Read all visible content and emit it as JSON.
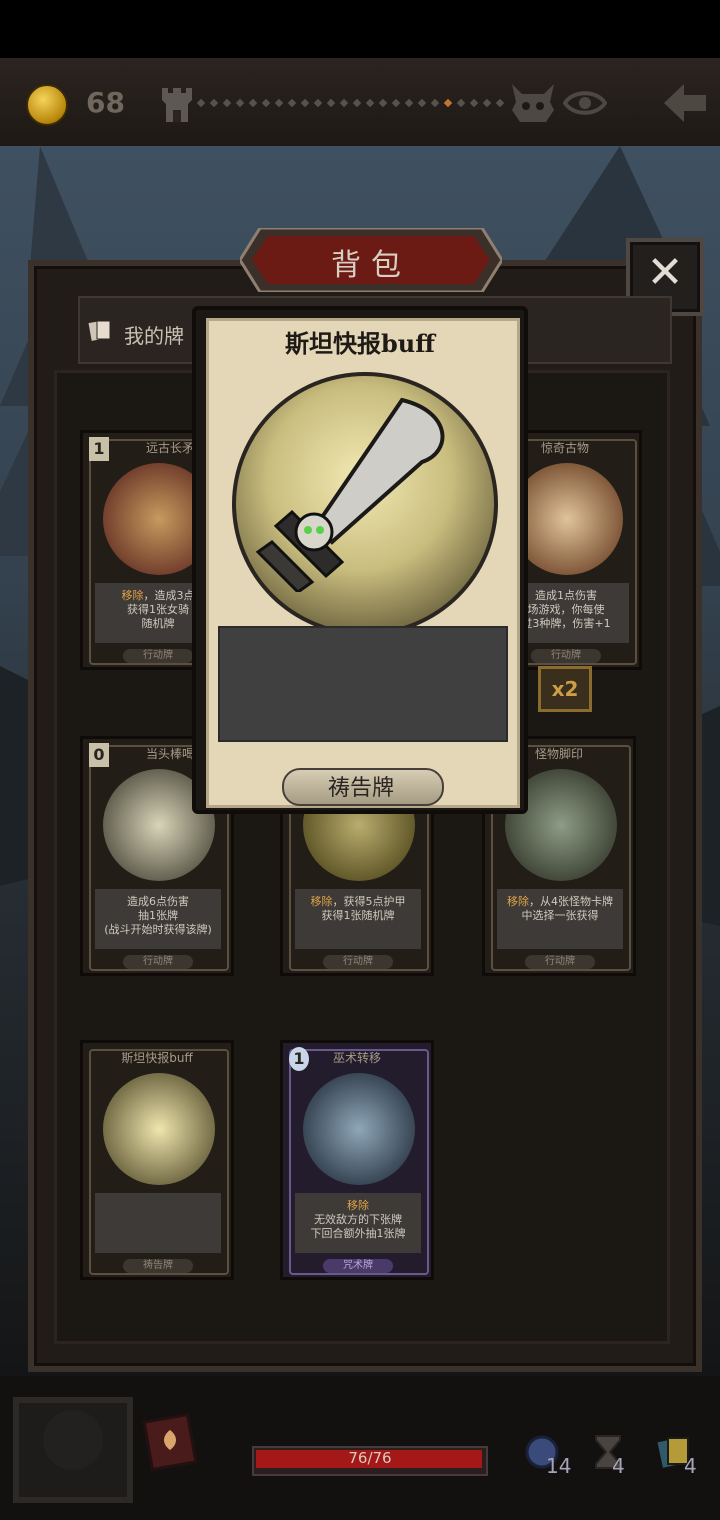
{
  "header": {
    "coins": "68"
  },
  "bag": {
    "title": "背包",
    "tab_label": "我的牌"
  },
  "popup": {
    "title": "斯坦快报buff",
    "type": "祷告牌"
  },
  "cards": [
    {
      "cost": "1",
      "name": "远古长矛",
      "desc_hl": "移除",
      "desc": "，造成3点\n获得1张女骑\n随机牌",
      "type": "行动牌"
    },
    {
      "cost": "",
      "name": "惊奇古物",
      "desc_hl": "",
      "desc": "造成1点伤害\n场游戏，你每使\n过3种牌，伤害+1",
      "type": "行动牌"
    },
    {
      "cost": "0",
      "name": "当头棒喝",
      "desc_hl": "",
      "desc": "造成6点伤害\n抽1张牌\n(战斗开始时获得该牌)",
      "type": "行动牌"
    },
    {
      "cost": "",
      "name": "",
      "desc_hl": "移除",
      "desc": "，获得5点护甲\n获得1张随机牌",
      "type": "行动牌"
    },
    {
      "cost": "",
      "name": "怪物脚印",
      "desc_hl": "移除",
      "desc": "，从4张怪物卡牌\n中选择一张获得",
      "type": "行动牌"
    },
    {
      "cost": "",
      "name": "斯坦快报buff",
      "desc_hl": "",
      "desc": "",
      "type": "祷告牌"
    },
    {
      "cost": "1",
      "name": "巫术转移",
      "desc_hl": "移除",
      "desc": "无效敌方的下张牌\n下回合额外抽1张牌",
      "type": "咒术牌"
    }
  ],
  "x2_badge": "x2",
  "footer": {
    "hp": "76/76",
    "hp_ratio": 1.0,
    "res1": "14",
    "res2": "4",
    "res3": "4"
  },
  "colors": {
    "highlight": "#e0a44a",
    "hp": "#a41818",
    "banner": "#6b1a14"
  },
  "icons": [
    "coin-icon",
    "castle-icon",
    "boss-icon",
    "eye-icon",
    "back-arrow-icon",
    "close-icon",
    "cards-icon",
    "spellbook-icon",
    "gem-icon",
    "hourglass-icon",
    "deck-icon"
  ]
}
